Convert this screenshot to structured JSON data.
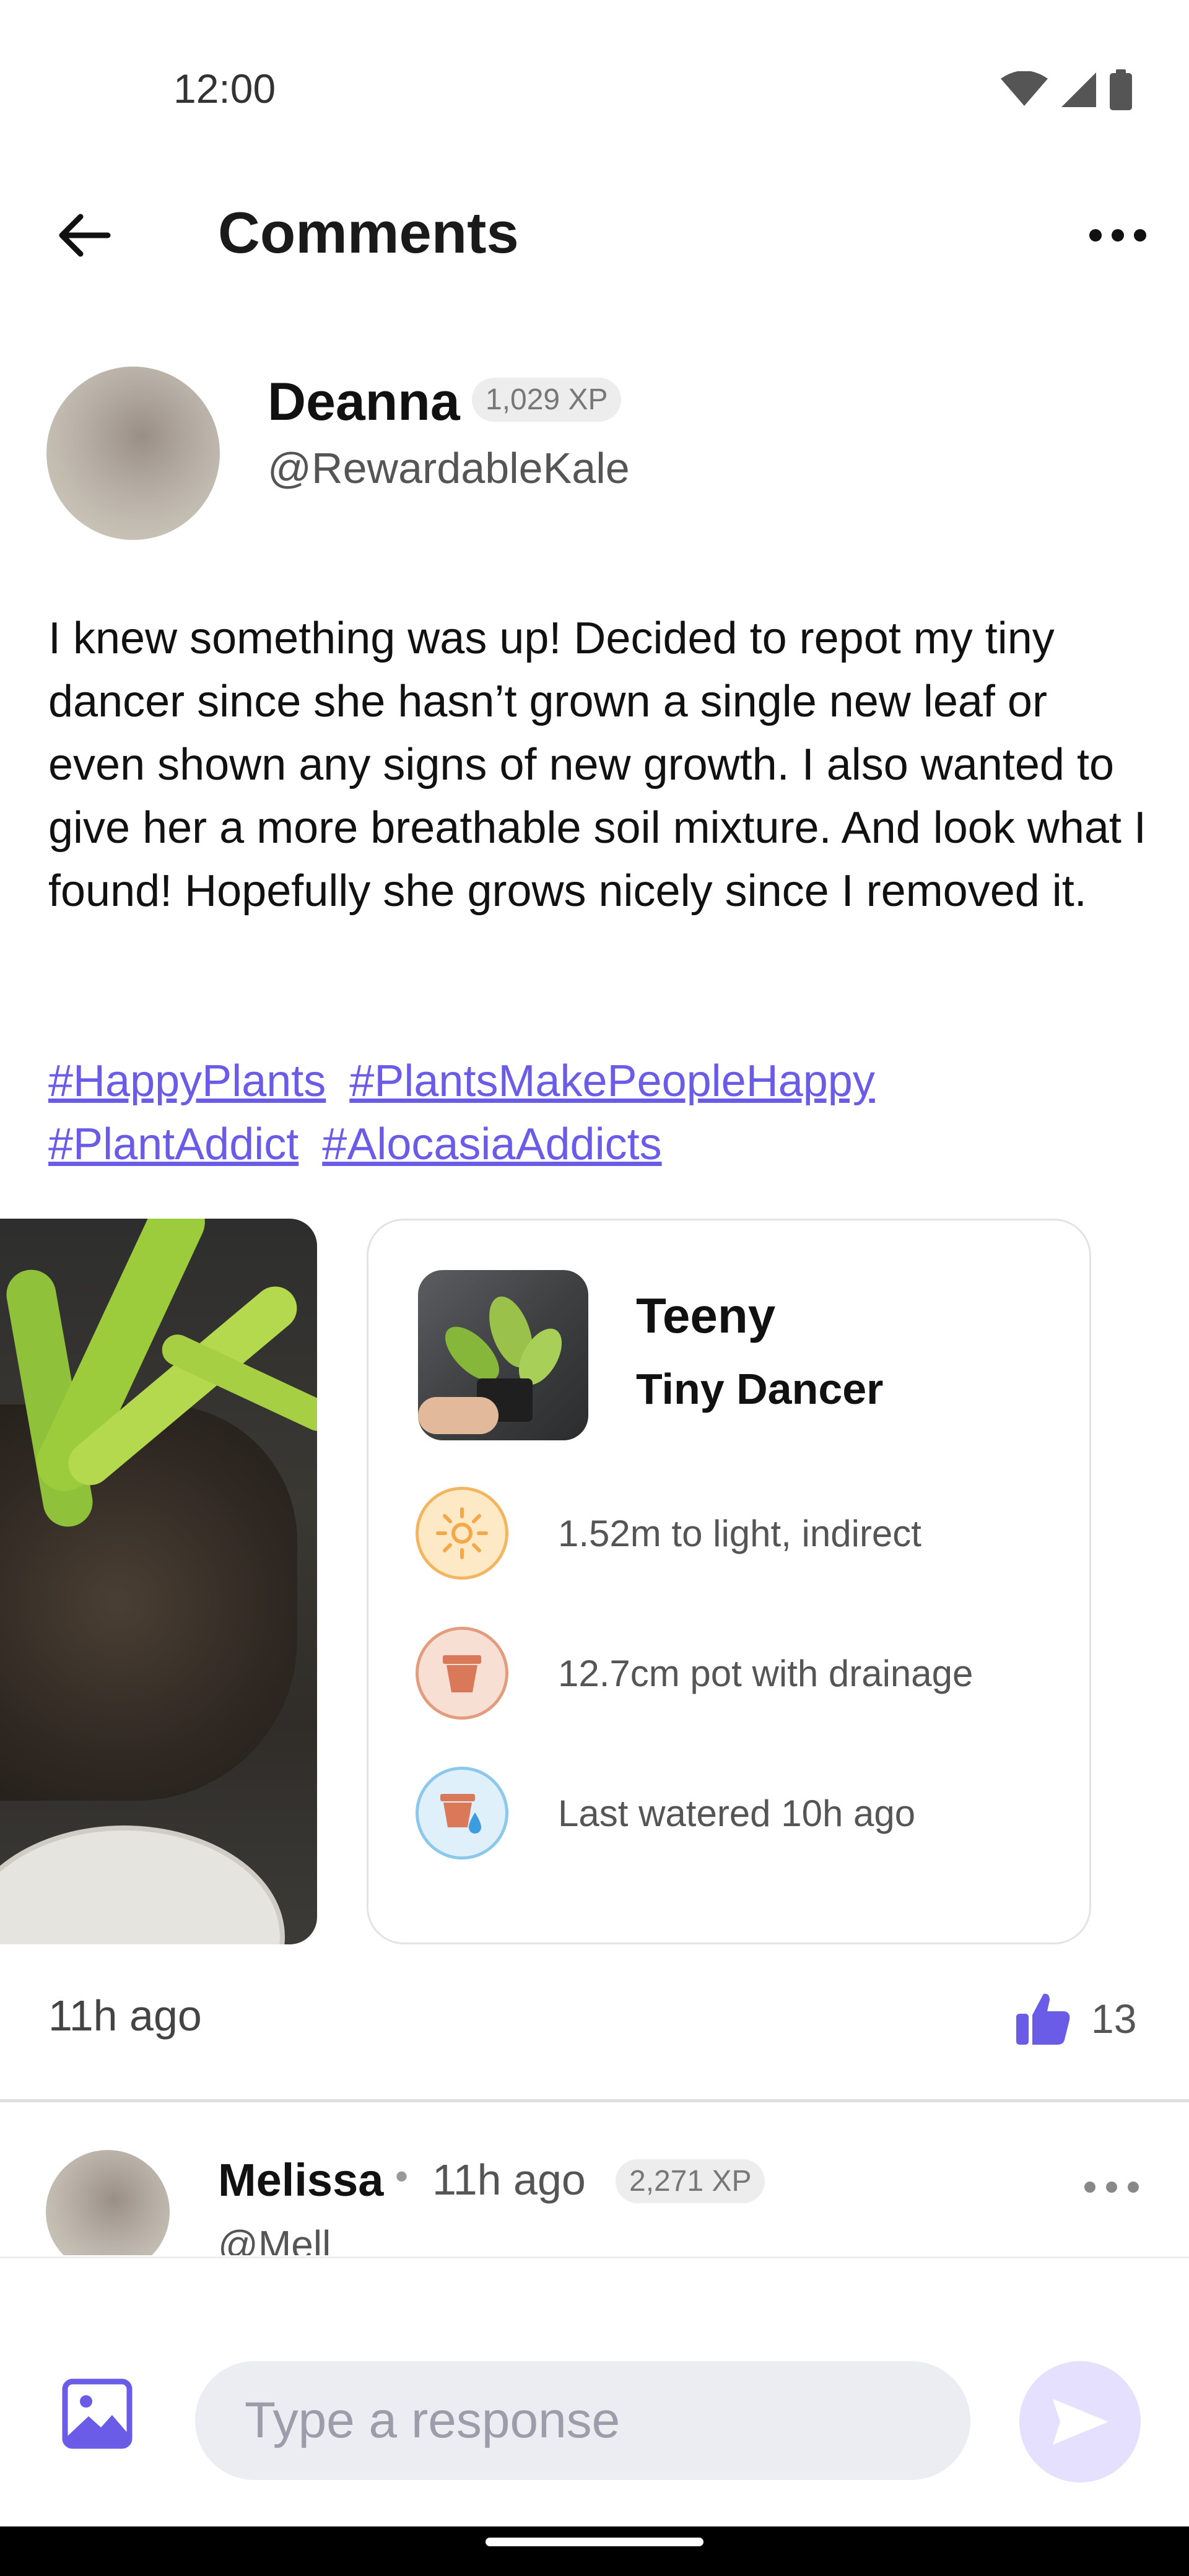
{
  "status_bar": {
    "time": "12:00",
    "icons": [
      "wifi-icon",
      "signal-icon",
      "battery-icon"
    ]
  },
  "app_bar": {
    "title": "Comments",
    "back_icon": "back-arrow-icon",
    "more_icon": "more-horizontal-icon"
  },
  "post": {
    "author": {
      "name": "Deanna",
      "xp": "1,029 XP",
      "handle": "@RewardableKale"
    },
    "body": "I knew something was up! Decided to repot my tiny dancer since she hasn’t grown a single new leaf or even shown any signs of new growth. I also wanted to give her a more breathable soil mixture. And look what I found! Hopefully she grows nicely since I removed it.",
    "hashtags": [
      "#HappyPlants",
      "#PlantsMakePeopleHappy",
      "#PlantAddict",
      "#AlocasiaAddicts"
    ],
    "plant_card": {
      "name": "Teeny",
      "species": "Tiny Dancer",
      "care": [
        {
          "icon": "sun-icon",
          "text": "1.52m to light, indirect"
        },
        {
          "icon": "pot-icon",
          "text": "12.7cm pot with drainage"
        },
        {
          "icon": "watering-pot-icon",
          "text": "Last watered 10h ago"
        }
      ]
    },
    "time_ago": "11h ago",
    "likes": "13"
  },
  "comment": {
    "name": "Melissa",
    "separator": "•",
    "time_ago": "11h ago",
    "xp": "2,271 XP",
    "handle": "@Mell"
  },
  "composer": {
    "placeholder": "Type a response"
  },
  "colors": {
    "accent": "#6b5ce7",
    "send_disabled": "#e4e0fd",
    "input_bg": "#ececf3"
  }
}
